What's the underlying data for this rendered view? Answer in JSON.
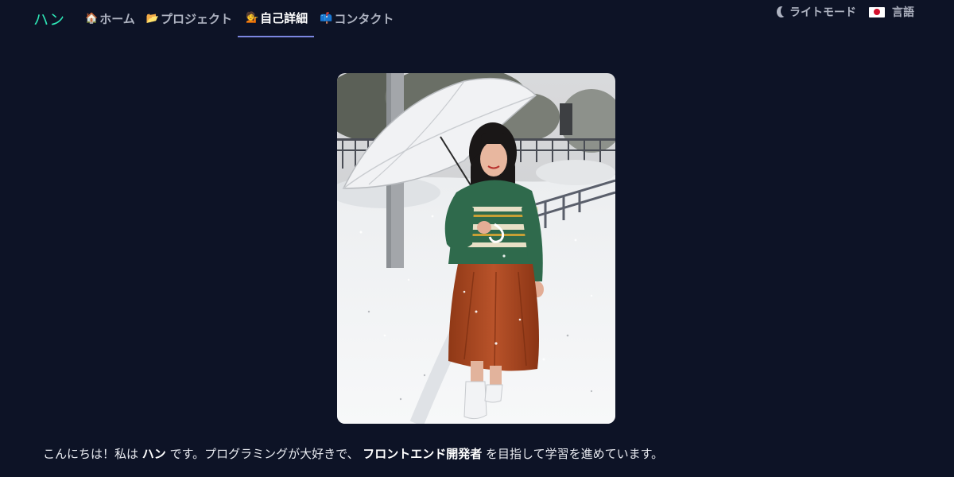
{
  "nav": {
    "brand": "ハン",
    "links": [
      {
        "emoji": "🏠",
        "label": "ホーム"
      },
      {
        "emoji": "📂",
        "label": "プロジェクト"
      },
      {
        "emoji": "💁",
        "label": "自己詳細"
      },
      {
        "emoji": "📫",
        "label": "コンタクト"
      }
    ],
    "active_index": 2,
    "theme_label": "ライトモード",
    "theme_icon": "moon-icon",
    "language_label": "言語",
    "language_icon": "japan-flag-icon"
  },
  "profile": {
    "photo_subject": "person-with-umbrella-in-snow",
    "intro": {
      "part1": "こんにちは！私は ",
      "name": "ハン",
      "part2": " です。プログラミングが大好きで、 ",
      "role": "フロントエンド開発者",
      "part3": " を目指して学習を進めています。"
    }
  },
  "colors": {
    "background": "#0d1326",
    "brand": "#2ee6b6",
    "active_underline": "#7b86e0",
    "nav_text": "#aeb3c1"
  }
}
